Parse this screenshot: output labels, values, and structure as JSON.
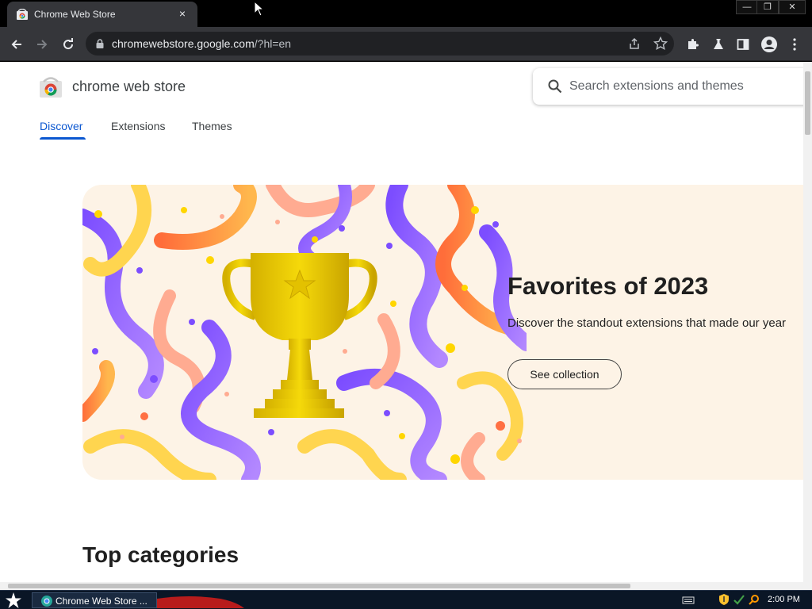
{
  "browser": {
    "tab_title": "Chrome Web Store",
    "tab_close": "×",
    "url_host": "chromewebstore.google.com",
    "url_path": "/?hl=en",
    "window_controls": {
      "minimize": "—",
      "maximize": "❐",
      "close": "✕"
    }
  },
  "store": {
    "name": "chrome web store",
    "search_placeholder": "Search extensions and themes",
    "nav": {
      "discover": "Discover",
      "extensions": "Extensions",
      "themes": "Themes"
    }
  },
  "hero": {
    "title": "Favorites of 2023",
    "description": "Discover the standout extensions that made our year",
    "button": "See collection"
  },
  "sections": {
    "top_categories": "Top categories"
  },
  "taskbar": {
    "task_label": "Chrome Web Store ...",
    "clock": "2:00 PM"
  },
  "colors": {
    "accent": "#0b57d0",
    "hero_background": "#fdf3e6",
    "toolbar": "#35363a",
    "omnibox": "#202124"
  }
}
